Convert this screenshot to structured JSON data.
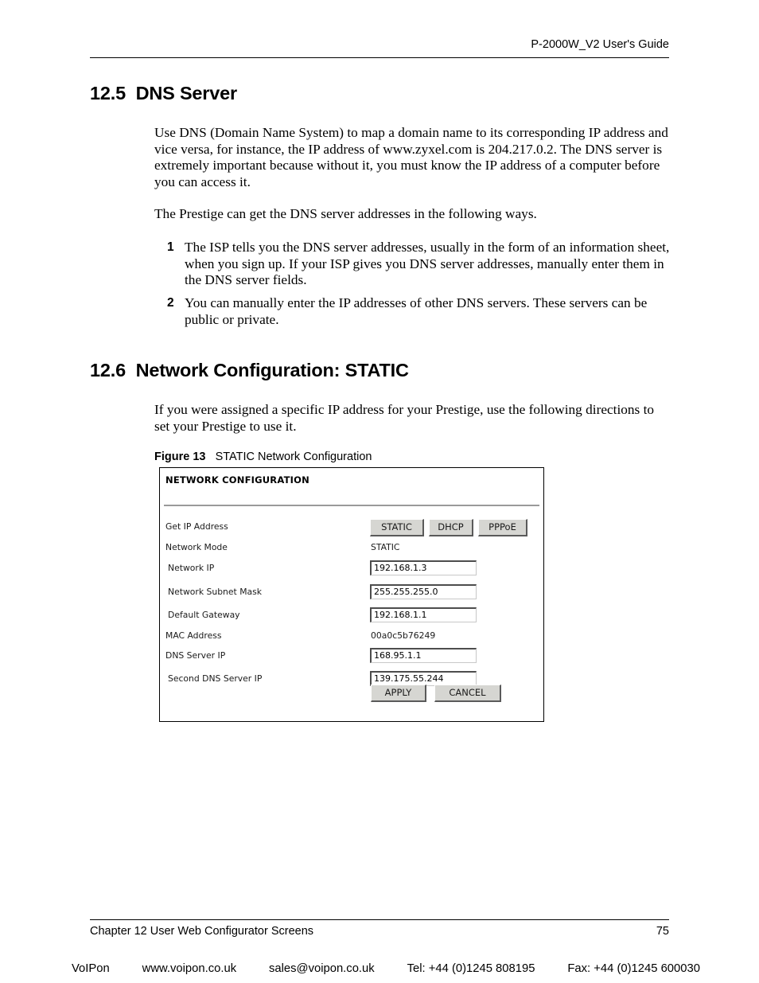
{
  "header": {
    "running_head": "P-2000W_V2 User's Guide"
  },
  "sections": {
    "dns": {
      "heading": "12.5  DNS Server",
      "paragraph_1": "Use DNS (Domain Name System) to map a domain name to its corresponding IP address and vice versa, for instance, the IP address of www.zyxel.com is 204.217.0.2. The DNS server is extremely important because without it, you must know the IP address of a computer before you can access it.",
      "paragraph_2": "The Prestige can get the DNS server addresses in the following ways.",
      "list": [
        {
          "number": "1",
          "text": "The ISP tells you the DNS server addresses, usually in the form of an information sheet, when you sign up. If your ISP gives you DNS server addresses, manually enter them in the DNS server fields."
        },
        {
          "number": "2",
          "text": "You can manually enter the IP addresses of other DNS servers. These servers can be public or private."
        }
      ]
    },
    "static": {
      "heading": "12.6  Network Configuration: STATIC",
      "paragraph_1": "If you were assigned a specific IP address for your Prestige, use the following directions to set your Prestige to use it."
    }
  },
  "figure": {
    "label": "Figure 13",
    "caption": "STATIC Network Configuration"
  },
  "config_panel": {
    "title": "NETWORK CONFIGURATION",
    "get_ip_address": {
      "label": "Get IP Address",
      "buttons": [
        "STATIC",
        "DHCP",
        "PPPoE"
      ]
    },
    "rows": [
      {
        "label": "Network Mode",
        "value": "STATIC",
        "type": "static"
      },
      {
        "label": "Network IP",
        "value": "192.168.1.3",
        "type": "input"
      },
      {
        "label": "Network Subnet Mask",
        "value": "255.255.255.0",
        "type": "input"
      },
      {
        "label": "Default Gateway",
        "value": "192.168.1.1",
        "type": "input"
      },
      {
        "label": "MAC Address",
        "value": "00a0c5b76249",
        "type": "static"
      },
      {
        "label": "DNS Server IP",
        "value": "168.95.1.1",
        "type": "input"
      },
      {
        "label": "Second DNS Server IP",
        "value": "139.175.55.244",
        "type": "input"
      }
    ],
    "actions": {
      "apply": "APPLY",
      "cancel": "CANCEL"
    }
  },
  "footer": {
    "chapter": "Chapter 12 User Web Configurator Screens",
    "page_number": "75",
    "voipon": {
      "brand": "VoIPon",
      "website": "www.voipon.co.uk",
      "email": "sales@voipon.co.uk",
      "tel": "Tel: +44 (0)1245 808195",
      "fax": "Fax: +44 (0)1245 600030"
    }
  }
}
